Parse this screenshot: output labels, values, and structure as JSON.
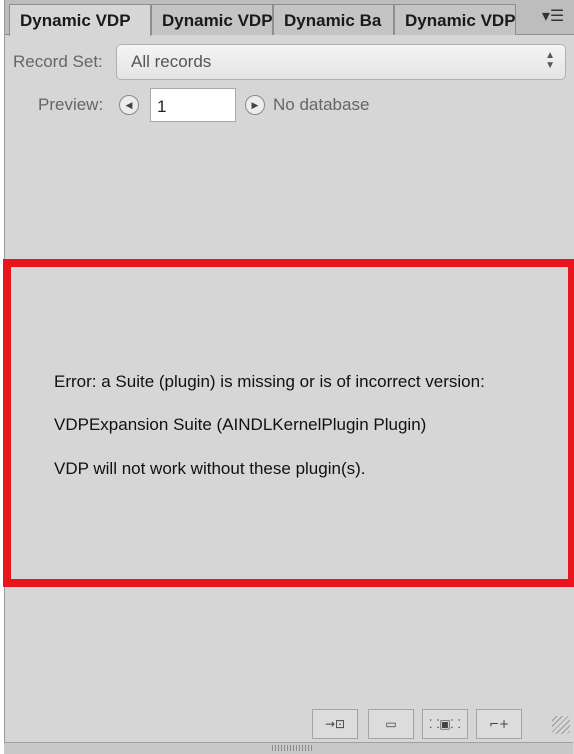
{
  "tabs": [
    {
      "label": "Dynamic VDP",
      "active": true
    },
    {
      "label": "Dynamic VDP",
      "active": false
    },
    {
      "label": "Dynamic Ba",
      "active": false
    },
    {
      "label": "Dynamic VDP",
      "active": false
    }
  ],
  "panel_menu_icon": "panel-menu-icon",
  "record_set": {
    "label": "Record Set:",
    "value": "All records"
  },
  "preview": {
    "label": "Preview:",
    "record_number": "1",
    "status": "No database"
  },
  "error": {
    "lines": [
      "Error: a Suite (plugin) is missing or is of incorrect version:",
      "VDPExpansion Suite (AINDLKernelPlugin Plugin)",
      "VDP will not work without these plugin(s)."
    ],
    "border_color": "#e8151c"
  },
  "toolbar": {
    "icons": [
      "insert-field-icon",
      "record-icon",
      "fit-frame-icon",
      "new-frame-icon"
    ]
  }
}
